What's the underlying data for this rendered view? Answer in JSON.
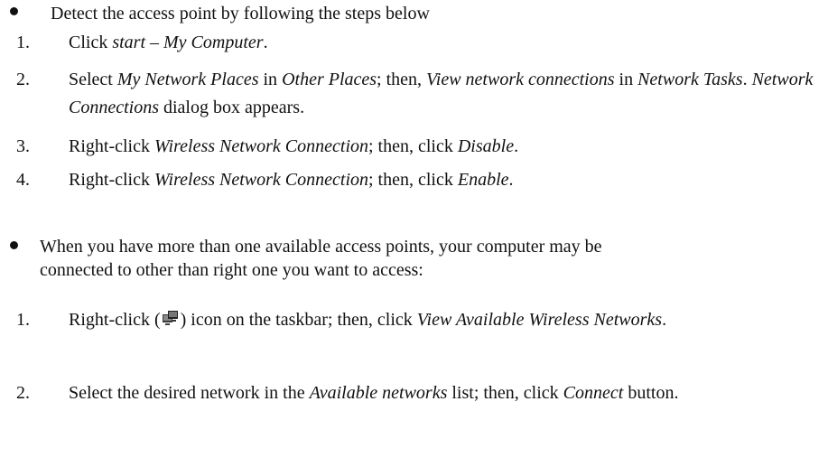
{
  "section1": {
    "intro": "Detect the access point by following the steps below",
    "steps": [
      {
        "num": "1.",
        "parts": [
          "Click ",
          "start – My Computer",
          "."
        ]
      },
      {
        "num": "2.",
        "parts": [
          "Select ",
          "My Network Places",
          " in ",
          "Other Places",
          "; then, ",
          "View network connections",
          " in ",
          "Network Tasks",
          ". ",
          "Network Connections",
          " dialog box appears."
        ]
      },
      {
        "num": "3.",
        "parts": [
          "Right-click ",
          "Wireless Network Connection",
          "; then, click ",
          "Disable",
          "."
        ]
      },
      {
        "num": "4.",
        "parts": [
          "Right-click ",
          "Wireless Network Connection",
          "; then, click ",
          "Enable",
          "."
        ]
      }
    ]
  },
  "section2": {
    "intro_line1": "When you have more than one available access points, your computer may be",
    "intro_line2": "connected to other than right one you want to access:",
    "steps": [
      {
        "num": "1.",
        "parts": [
          "Right-click (",
          ") icon on the taskbar; then, click ",
          "View Available Wireless Networks",
          "."
        ]
      },
      {
        "num": "2.",
        "parts": [
          "Select the desired network in the ",
          "Available networks",
          " list; then, click ",
          "Connect",
          " button."
        ]
      }
    ]
  },
  "icons": {
    "taskbar_network": "wireless-network-tray-icon"
  }
}
